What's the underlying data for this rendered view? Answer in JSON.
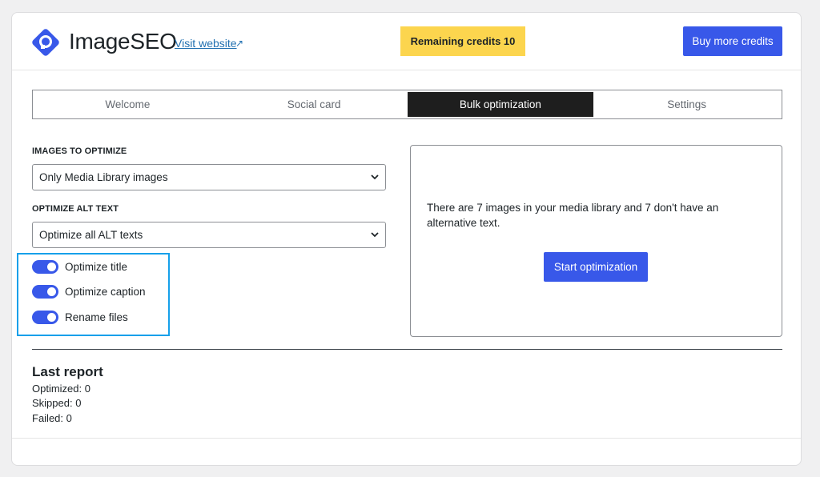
{
  "header": {
    "app_name": "ImageSEO",
    "visit_link": "Visit website",
    "visit_arrow": "↗",
    "credits_label": "Remaining credits 10",
    "buy_button": "Buy more credits",
    "logo_icon": "imageseo-logo-icon",
    "accent_color": "#3858e9",
    "credits_color": "#fcd54e"
  },
  "tabs": [
    {
      "label": "Welcome",
      "active": false
    },
    {
      "label": "Social card",
      "active": false
    },
    {
      "label": "Bulk optimization",
      "active": true
    },
    {
      "label": "Settings",
      "active": false
    }
  ],
  "form": {
    "images_label": "IMAGES TO OPTIMIZE",
    "images_value": "Only Media Library images",
    "alt_label": "OPTIMIZE ALT TEXT",
    "alt_value": "Optimize all ALT texts",
    "toggles": [
      {
        "label": "Optimize title",
        "on": true
      },
      {
        "label": "Optimize caption",
        "on": true
      },
      {
        "label": "Rename files",
        "on": true
      }
    ]
  },
  "panel": {
    "message": "There are 7 images in your media library and 7 don't have an alternative text.",
    "start_button": "Start optimization"
  },
  "report": {
    "title": "Last report",
    "optimized": "Optimized: 0",
    "skipped": "Skipped: 0",
    "failed": "Failed: 0"
  }
}
